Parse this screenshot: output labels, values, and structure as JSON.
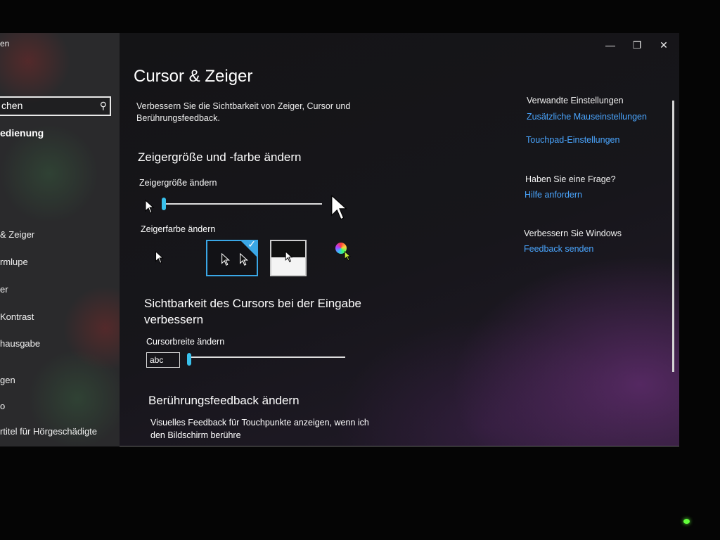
{
  "window": {
    "app_title": "en",
    "minimize_icon": "minimize-icon",
    "restore_icon": "restore-icon",
    "close_icon": "close-icon"
  },
  "sidebar": {
    "search_value": "chen",
    "search_icon": "search-icon",
    "heading": "edienung",
    "items": [
      {
        "label": "& Zeiger"
      },
      {
        "label": "rmlupe"
      },
      {
        "label": "er"
      },
      {
        "label": "Kontrast"
      },
      {
        "label": "hausgabe"
      },
      {
        "label": "gen"
      },
      {
        "label": "o"
      },
      {
        "label": "rtitel für Hörgeschädigte"
      }
    ]
  },
  "main": {
    "title": "Cursor & Zeiger",
    "intro": "Verbessern Sie die Sichtbarkeit von Zeiger, Cursor und Berührungsfeedback.",
    "size_color_heading": "Zeigergröße und -farbe ändern",
    "size_label": "Zeigergröße ändern",
    "size_value_percent": 0,
    "color_label": "Zeigerfarbe ändern",
    "color_options": [
      "white",
      "black",
      "inverted",
      "custom"
    ],
    "selected_color": "black",
    "cursor_heading": "Sichtbarkeit des Cursors bei der Eingabe verbessern",
    "cursor_width_label": "Cursorbreite ändern",
    "cursor_sample": "abc",
    "cursor_width_value_percent": 0,
    "touch_heading": "Berührungsfeedback ändern",
    "touch_text": "Visuelles Feedback für Touchpunkte anzeigen, wenn ich den Bildschirm berühre"
  },
  "related": {
    "heading": "Verwandte Einstellungen",
    "link1": "Zusätzliche Mauseinstellungen",
    "link2": "Touchpad-Einstellungen",
    "question_heading": "Haben Sie eine Frage?",
    "help_link": "Hilfe anfordern",
    "improve_heading": "Verbessern Sie Windows",
    "feedback_link": "Feedback senden"
  },
  "colors": {
    "accent": "#3aa7e6",
    "slider_thumb": "#39c1ec",
    "link": "#4aa6ff"
  }
}
